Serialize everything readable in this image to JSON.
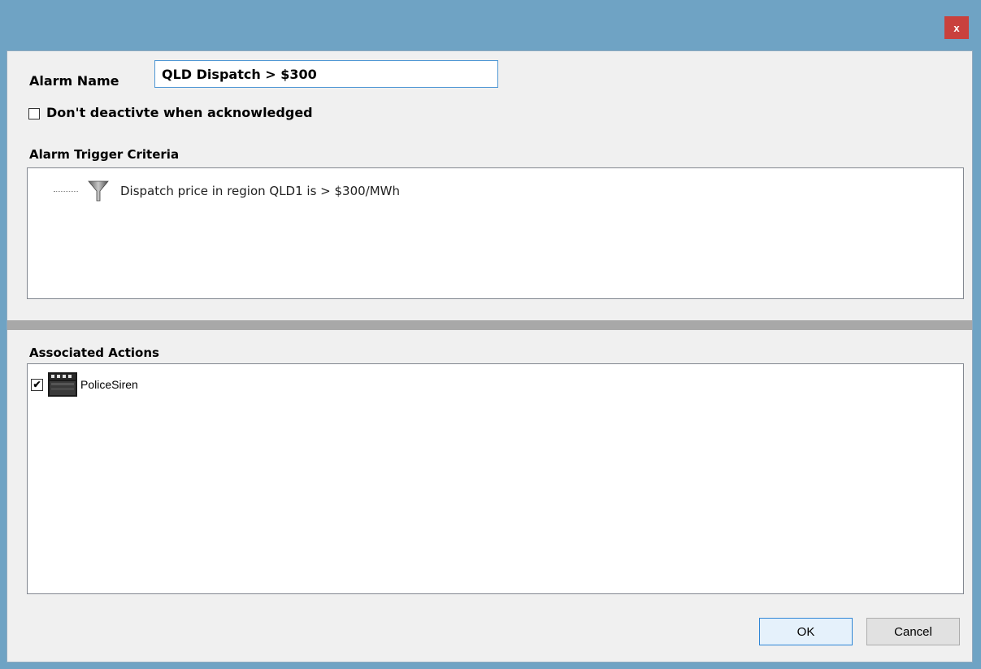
{
  "window": {
    "close_label": "x"
  },
  "form": {
    "alarm_name_label": "Alarm Name",
    "alarm_name_value": "QLD Dispatch > $300",
    "dont_deactivate_label": "Don't deactivte when acknowledged",
    "dont_deactivate_checked": false
  },
  "trigger": {
    "title": "Alarm Trigger Criteria",
    "criteria": [
      {
        "text": "Dispatch price in region QLD1 is > $300/MWh",
        "icon": "filter-icon"
      }
    ]
  },
  "actions": {
    "title": "Associated Actions",
    "items": [
      {
        "label": "PoliceSiren",
        "checked": true,
        "icon": "clapperboard-icon"
      }
    ]
  },
  "buttons": {
    "ok_label": "OK",
    "cancel_label": "Cancel"
  },
  "colors": {
    "title_bar": "#6fa3c4",
    "close_button": "#c9413d",
    "input_border": "#4f97d4"
  }
}
